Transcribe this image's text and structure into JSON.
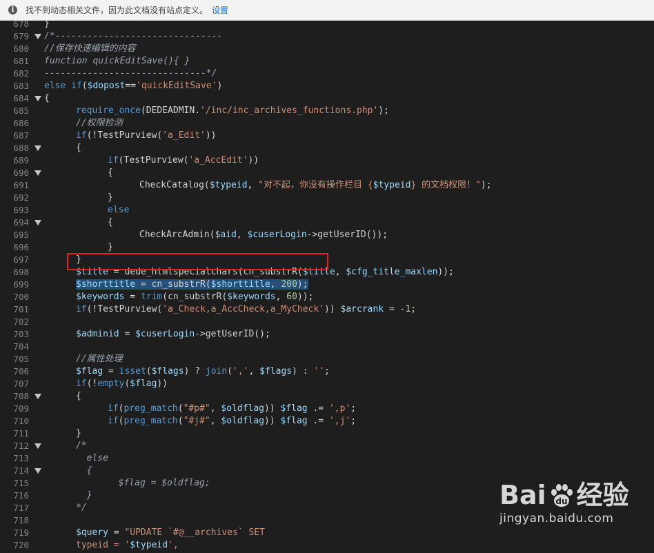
{
  "infobar": {
    "icon": "info-icon",
    "message": "找不到动态相关文件，因为此文档没有站点定义。",
    "link_label": "设置"
  },
  "colors": {
    "keyword": "#569cd6",
    "comment": "#9ca3af",
    "string": "#ce9178",
    "variable": "#9cdcfe",
    "number": "#b5cea8",
    "text": "#d4d4d4",
    "highlight_border": "#e2231a",
    "selection": "#264f78"
  },
  "code_lines": [
    {
      "n": "678",
      "fold": false,
      "indent": 0,
      "tokens": [
        [
          "t",
          "}"
        ]
      ]
    },
    {
      "n": "679",
      "fold": true,
      "indent": 0,
      "tokens": [
        [
          "c",
          "/*-------------------------------"
        ]
      ]
    },
    {
      "n": "680",
      "fold": false,
      "indent": 0,
      "tokens": [
        [
          "c",
          "//保存快速编辑的内容"
        ]
      ]
    },
    {
      "n": "681",
      "fold": false,
      "indent": 0,
      "tokens": [
        [
          "c",
          "function quickEditSave(){ }"
        ]
      ]
    },
    {
      "n": "682",
      "fold": false,
      "indent": 0,
      "tokens": [
        [
          "c",
          "------------------------------*/"
        ]
      ]
    },
    {
      "n": "683",
      "fold": false,
      "indent": 0,
      "tokens": [
        [
          "k",
          "else if"
        ],
        [
          "t",
          "("
        ],
        [
          "v",
          "$dopost"
        ],
        [
          "t",
          "=="
        ],
        [
          "s",
          "'quickEditSave'"
        ],
        [
          "t",
          ")"
        ]
      ]
    },
    {
      "n": "684",
      "fold": true,
      "indent": 0,
      "tokens": [
        [
          "t",
          "{"
        ]
      ]
    },
    {
      "n": "685",
      "fold": false,
      "indent": 1,
      "tokens": [
        [
          "k",
          "require_once"
        ],
        [
          "t",
          "(DEDEADMIN."
        ],
        [
          "s",
          "'/inc/inc_archives_functions.php'"
        ],
        [
          "t",
          ");"
        ]
      ]
    },
    {
      "n": "686",
      "fold": false,
      "indent": 1,
      "tokens": [
        [
          "c",
          "//权限检测"
        ]
      ]
    },
    {
      "n": "687",
      "fold": false,
      "indent": 1,
      "tokens": [
        [
          "k",
          "if"
        ],
        [
          "t",
          "(!TestPurview("
        ],
        [
          "s",
          "'a_Edit'"
        ],
        [
          "t",
          "))"
        ]
      ]
    },
    {
      "n": "688",
      "fold": true,
      "indent": 1,
      "tokens": [
        [
          "t",
          "{"
        ]
      ]
    },
    {
      "n": "689",
      "fold": false,
      "indent": 2,
      "tokens": [
        [
          "k",
          "if"
        ],
        [
          "t",
          "(TestPurview("
        ],
        [
          "s",
          "'a_AccEdit'"
        ],
        [
          "t",
          "))"
        ]
      ]
    },
    {
      "n": "690",
      "fold": true,
      "indent": 2,
      "tokens": [
        [
          "t",
          "{"
        ]
      ]
    },
    {
      "n": "691",
      "fold": false,
      "indent": 3,
      "tokens": [
        [
          "t",
          "CheckCatalog("
        ],
        [
          "v",
          "$typeid"
        ],
        [
          "t",
          ", "
        ],
        [
          "s",
          "\"对不起，你没有操作栏目 {"
        ],
        [
          "v",
          "$typeid"
        ],
        [
          "s",
          "} 的文档权限！\""
        ],
        [
          "t",
          ");"
        ]
      ]
    },
    {
      "n": "692",
      "fold": false,
      "indent": 2,
      "tokens": [
        [
          "t",
          "}"
        ]
      ]
    },
    {
      "n": "693",
      "fold": false,
      "indent": 2,
      "tokens": [
        [
          "k",
          "else"
        ]
      ]
    },
    {
      "n": "694",
      "fold": true,
      "indent": 2,
      "tokens": [
        [
          "t",
          "{"
        ]
      ]
    },
    {
      "n": "695",
      "fold": false,
      "indent": 3,
      "tokens": [
        [
          "t",
          "CheckArcAdmin("
        ],
        [
          "v",
          "$aid"
        ],
        [
          "t",
          ", "
        ],
        [
          "v",
          "$cuserLogin"
        ],
        [
          "t",
          "->getUserID());"
        ]
      ]
    },
    {
      "n": "696",
      "fold": false,
      "indent": 2,
      "tokens": [
        [
          "t",
          "}"
        ]
      ]
    },
    {
      "n": "697",
      "fold": false,
      "indent": 1,
      "tokens": [
        [
          "t",
          "}"
        ]
      ]
    },
    {
      "n": "698",
      "fold": false,
      "indent": 1,
      "tokens": [
        [
          "v",
          "$title"
        ],
        [
          "t",
          " = dede_htmlspecialchars(cn_substrR("
        ],
        [
          "v",
          "$title"
        ],
        [
          "t",
          ", "
        ],
        [
          "v",
          "$cfg_title_maxlen"
        ],
        [
          "t",
          "));"
        ]
      ]
    },
    {
      "n": "699",
      "fold": false,
      "indent": 1,
      "selected": true,
      "tokens": [
        [
          "v",
          "$shorttitle"
        ],
        [
          "t",
          " = cn_substrR("
        ],
        [
          "v",
          "$shorttitle"
        ],
        [
          "t",
          ", "
        ],
        [
          "n",
          "200"
        ],
        [
          "t",
          ");"
        ]
      ]
    },
    {
      "n": "700",
      "fold": false,
      "indent": 1,
      "tokens": [
        [
          "v",
          "$keywords"
        ],
        [
          "t",
          " = "
        ],
        [
          "k",
          "trim"
        ],
        [
          "t",
          "(cn_substrR("
        ],
        [
          "v",
          "$keywords"
        ],
        [
          "t",
          ", "
        ],
        [
          "n",
          "60"
        ],
        [
          "t",
          "));"
        ]
      ]
    },
    {
      "n": "701",
      "fold": false,
      "indent": 1,
      "tokens": [
        [
          "k",
          "if"
        ],
        [
          "t",
          "(!TestPurview("
        ],
        [
          "s",
          "'a_Check,a_AccCheck,a_MyCheck'"
        ],
        [
          "t",
          ")) "
        ],
        [
          "v",
          "$arcrank"
        ],
        [
          "t",
          " = "
        ],
        [
          "n",
          "-1"
        ],
        [
          "t",
          ";"
        ]
      ]
    },
    {
      "n": "702",
      "fold": false,
      "indent": 0,
      "tokens": []
    },
    {
      "n": "703",
      "fold": false,
      "indent": 1,
      "tokens": [
        [
          "v",
          "$adminid"
        ],
        [
          "t",
          " = "
        ],
        [
          "v",
          "$cuserLogin"
        ],
        [
          "t",
          "->getUserID();"
        ]
      ]
    },
    {
      "n": "704",
      "fold": false,
      "indent": 0,
      "tokens": []
    },
    {
      "n": "705",
      "fold": false,
      "indent": 1,
      "tokens": [
        [
          "c",
          "//属性处理"
        ]
      ]
    },
    {
      "n": "706",
      "fold": false,
      "indent": 1,
      "tokens": [
        [
          "v",
          "$flag"
        ],
        [
          "t",
          " = "
        ],
        [
          "k",
          "isset"
        ],
        [
          "t",
          "("
        ],
        [
          "v",
          "$flags"
        ],
        [
          "t",
          ") ? "
        ],
        [
          "k",
          "join"
        ],
        [
          "t",
          "("
        ],
        [
          "s",
          "','"
        ],
        [
          "t",
          ", "
        ],
        [
          "v",
          "$flags"
        ],
        [
          "t",
          ") : "
        ],
        [
          "s",
          "''"
        ],
        [
          "t",
          ";"
        ]
      ]
    },
    {
      "n": "707",
      "fold": false,
      "indent": 1,
      "tokens": [
        [
          "k",
          "if"
        ],
        [
          "t",
          "(!"
        ],
        [
          "k",
          "empty"
        ],
        [
          "t",
          "("
        ],
        [
          "v",
          "$flag"
        ],
        [
          "t",
          "))"
        ]
      ]
    },
    {
      "n": "708",
      "fold": true,
      "indent": 1,
      "tokens": [
        [
          "t",
          "{"
        ]
      ]
    },
    {
      "n": "709",
      "fold": false,
      "indent": 2,
      "tokens": [
        [
          "k",
          "if"
        ],
        [
          "t",
          "("
        ],
        [
          "k",
          "preg_match"
        ],
        [
          "t",
          "("
        ],
        [
          "s",
          "\"#p#\""
        ],
        [
          "t",
          ", "
        ],
        [
          "v",
          "$oldflag"
        ],
        [
          "t",
          ")) "
        ],
        [
          "v",
          "$flag"
        ],
        [
          "t",
          " .= "
        ],
        [
          "s",
          "',p'"
        ],
        [
          "t",
          ";"
        ]
      ]
    },
    {
      "n": "710",
      "fold": false,
      "indent": 2,
      "tokens": [
        [
          "k",
          "if"
        ],
        [
          "t",
          "("
        ],
        [
          "k",
          "preg_match"
        ],
        [
          "t",
          "("
        ],
        [
          "s",
          "\"#j#\""
        ],
        [
          "t",
          ", "
        ],
        [
          "v",
          "$oldflag"
        ],
        [
          "t",
          ")) "
        ],
        [
          "v",
          "$flag"
        ],
        [
          "t",
          " .= "
        ],
        [
          "s",
          "',j'"
        ],
        [
          "t",
          ";"
        ]
      ]
    },
    {
      "n": "711",
      "fold": false,
      "indent": 1,
      "tokens": [
        [
          "t",
          "}"
        ]
      ]
    },
    {
      "n": "712",
      "fold": true,
      "indent": 1,
      "tokens": [
        [
          "c",
          "/*"
        ]
      ]
    },
    {
      "n": "713",
      "fold": false,
      "indent": 1,
      "tokens": [
        [
          "c",
          "  else"
        ]
      ]
    },
    {
      "n": "714",
      "fold": true,
      "indent": 1,
      "tokens": [
        [
          "c",
          "  {"
        ]
      ]
    },
    {
      "n": "715",
      "fold": false,
      "indent": 2,
      "tokens": [
        [
          "c",
          "  $flag = $oldflag;"
        ]
      ]
    },
    {
      "n": "716",
      "fold": false,
      "indent": 1,
      "tokens": [
        [
          "c",
          "  }"
        ]
      ]
    },
    {
      "n": "717",
      "fold": false,
      "indent": 1,
      "tokens": [
        [
          "c",
          "*/"
        ]
      ]
    },
    {
      "n": "718",
      "fold": false,
      "indent": 0,
      "tokens": []
    },
    {
      "n": "719",
      "fold": false,
      "indent": 1,
      "tokens": [
        [
          "v",
          "$query"
        ],
        [
          "t",
          " = "
        ],
        [
          "s",
          "\"UPDATE `#@__archives` SET"
        ]
      ]
    },
    {
      "n": "720",
      "fold": false,
      "indent": 1,
      "tokens": [
        [
          "s",
          "typeid = '"
        ],
        [
          "v",
          "$typeid"
        ],
        [
          "s",
          "',"
        ]
      ]
    }
  ],
  "watermark": {
    "brand": "Bai",
    "brand_suffix": "经验",
    "url": "jingyan.baidu.com"
  }
}
